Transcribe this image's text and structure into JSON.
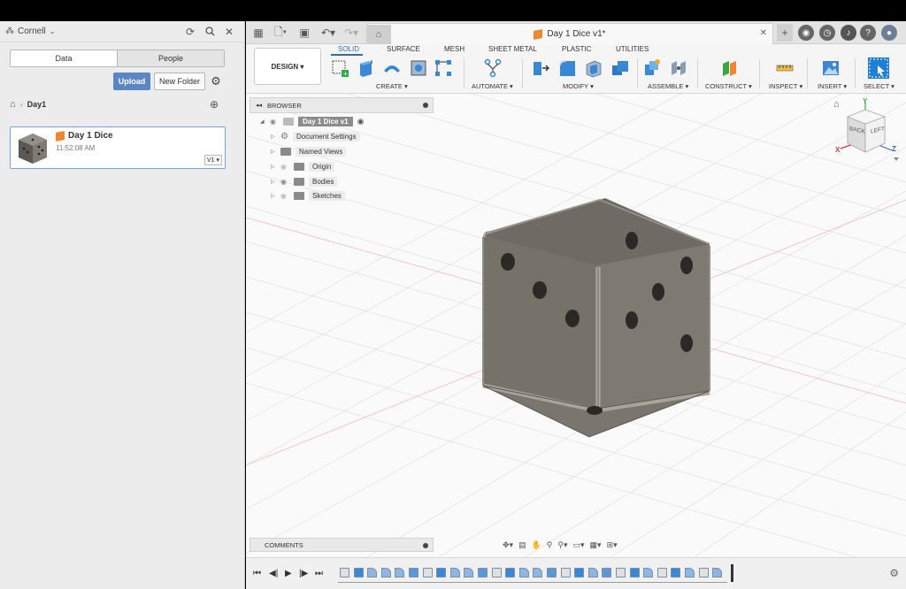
{
  "left_panel": {
    "team_name": "Cornell",
    "tabs": [
      "Data",
      "People"
    ],
    "upload_label": "Upload",
    "new_folder_label": "New Folder",
    "breadcrumb": "Day1",
    "file": {
      "name": "Day 1 Dice",
      "time": "11:52:08 AM",
      "version": "V1 ▾"
    }
  },
  "document": {
    "tab_title": "Day 1 Dice v1*"
  },
  "toolbar": {
    "design_label": "DESIGN ▾",
    "workspace_tabs": [
      "SOLID",
      "SURFACE",
      "MESH",
      "SHEET METAL",
      "PLASTIC",
      "UTILITIES"
    ],
    "groups": [
      "CREATE ▾",
      "AUTOMATE ▾",
      "MODIFY ▾",
      "ASSEMBLE ▾",
      "CONSTRUCT ▾",
      "INSPECT ▾",
      "INSERT ▾",
      "SELECT ▾"
    ]
  },
  "browser": {
    "title": "BROWSER",
    "root": "Day 1 Dice v1",
    "items": [
      "Document Settings",
      "Named Views",
      "Origin",
      "Bodies",
      "Sketches"
    ]
  },
  "comments_label": "COMMENTS",
  "viewcube": {
    "back": "BACK",
    "left": "LEFT",
    "x": "X",
    "y": "Y",
    "z": "Z"
  },
  "colors": {
    "accent": "#2d6bb3",
    "upload": "#5b86c4",
    "dice": "#807b73",
    "file_icon": "#f0862d"
  }
}
